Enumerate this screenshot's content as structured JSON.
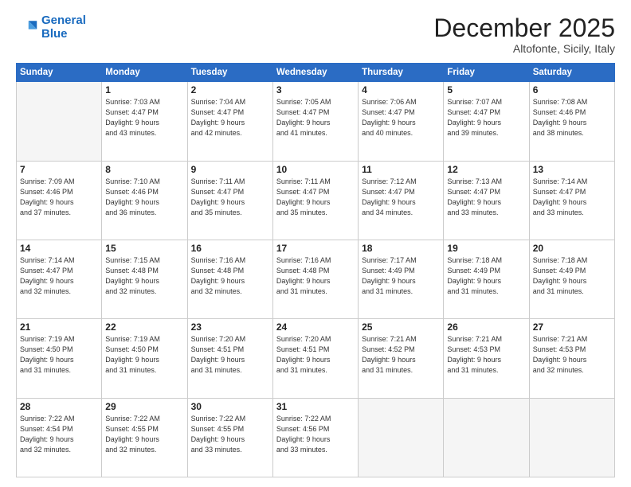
{
  "header": {
    "logo_line1": "General",
    "logo_line2": "Blue",
    "month": "December 2025",
    "location": "Altofonte, Sicily, Italy"
  },
  "weekdays": [
    "Sunday",
    "Monday",
    "Tuesday",
    "Wednesday",
    "Thursday",
    "Friday",
    "Saturday"
  ],
  "weeks": [
    [
      {
        "day": "",
        "info": ""
      },
      {
        "day": "1",
        "info": "Sunrise: 7:03 AM\nSunset: 4:47 PM\nDaylight: 9 hours\nand 43 minutes."
      },
      {
        "day": "2",
        "info": "Sunrise: 7:04 AM\nSunset: 4:47 PM\nDaylight: 9 hours\nand 42 minutes."
      },
      {
        "day": "3",
        "info": "Sunrise: 7:05 AM\nSunset: 4:47 PM\nDaylight: 9 hours\nand 41 minutes."
      },
      {
        "day": "4",
        "info": "Sunrise: 7:06 AM\nSunset: 4:47 PM\nDaylight: 9 hours\nand 40 minutes."
      },
      {
        "day": "5",
        "info": "Sunrise: 7:07 AM\nSunset: 4:47 PM\nDaylight: 9 hours\nand 39 minutes."
      },
      {
        "day": "6",
        "info": "Sunrise: 7:08 AM\nSunset: 4:46 PM\nDaylight: 9 hours\nand 38 minutes."
      }
    ],
    [
      {
        "day": "7",
        "info": "Sunrise: 7:09 AM\nSunset: 4:46 PM\nDaylight: 9 hours\nand 37 minutes."
      },
      {
        "day": "8",
        "info": "Sunrise: 7:10 AM\nSunset: 4:46 PM\nDaylight: 9 hours\nand 36 minutes."
      },
      {
        "day": "9",
        "info": "Sunrise: 7:11 AM\nSunset: 4:47 PM\nDaylight: 9 hours\nand 35 minutes."
      },
      {
        "day": "10",
        "info": "Sunrise: 7:11 AM\nSunset: 4:47 PM\nDaylight: 9 hours\nand 35 minutes."
      },
      {
        "day": "11",
        "info": "Sunrise: 7:12 AM\nSunset: 4:47 PM\nDaylight: 9 hours\nand 34 minutes."
      },
      {
        "day": "12",
        "info": "Sunrise: 7:13 AM\nSunset: 4:47 PM\nDaylight: 9 hours\nand 33 minutes."
      },
      {
        "day": "13",
        "info": "Sunrise: 7:14 AM\nSunset: 4:47 PM\nDaylight: 9 hours\nand 33 minutes."
      }
    ],
    [
      {
        "day": "14",
        "info": "Sunrise: 7:14 AM\nSunset: 4:47 PM\nDaylight: 9 hours\nand 32 minutes."
      },
      {
        "day": "15",
        "info": "Sunrise: 7:15 AM\nSunset: 4:48 PM\nDaylight: 9 hours\nand 32 minutes."
      },
      {
        "day": "16",
        "info": "Sunrise: 7:16 AM\nSunset: 4:48 PM\nDaylight: 9 hours\nand 32 minutes."
      },
      {
        "day": "17",
        "info": "Sunrise: 7:16 AM\nSunset: 4:48 PM\nDaylight: 9 hours\nand 31 minutes."
      },
      {
        "day": "18",
        "info": "Sunrise: 7:17 AM\nSunset: 4:49 PM\nDaylight: 9 hours\nand 31 minutes."
      },
      {
        "day": "19",
        "info": "Sunrise: 7:18 AM\nSunset: 4:49 PM\nDaylight: 9 hours\nand 31 minutes."
      },
      {
        "day": "20",
        "info": "Sunrise: 7:18 AM\nSunset: 4:49 PM\nDaylight: 9 hours\nand 31 minutes."
      }
    ],
    [
      {
        "day": "21",
        "info": "Sunrise: 7:19 AM\nSunset: 4:50 PM\nDaylight: 9 hours\nand 31 minutes."
      },
      {
        "day": "22",
        "info": "Sunrise: 7:19 AM\nSunset: 4:50 PM\nDaylight: 9 hours\nand 31 minutes."
      },
      {
        "day": "23",
        "info": "Sunrise: 7:20 AM\nSunset: 4:51 PM\nDaylight: 9 hours\nand 31 minutes."
      },
      {
        "day": "24",
        "info": "Sunrise: 7:20 AM\nSunset: 4:51 PM\nDaylight: 9 hours\nand 31 minutes."
      },
      {
        "day": "25",
        "info": "Sunrise: 7:21 AM\nSunset: 4:52 PM\nDaylight: 9 hours\nand 31 minutes."
      },
      {
        "day": "26",
        "info": "Sunrise: 7:21 AM\nSunset: 4:53 PM\nDaylight: 9 hours\nand 31 minutes."
      },
      {
        "day": "27",
        "info": "Sunrise: 7:21 AM\nSunset: 4:53 PM\nDaylight: 9 hours\nand 32 minutes."
      }
    ],
    [
      {
        "day": "28",
        "info": "Sunrise: 7:22 AM\nSunset: 4:54 PM\nDaylight: 9 hours\nand 32 minutes."
      },
      {
        "day": "29",
        "info": "Sunrise: 7:22 AM\nSunset: 4:55 PM\nDaylight: 9 hours\nand 32 minutes."
      },
      {
        "day": "30",
        "info": "Sunrise: 7:22 AM\nSunset: 4:55 PM\nDaylight: 9 hours\nand 33 minutes."
      },
      {
        "day": "31",
        "info": "Sunrise: 7:22 AM\nSunset: 4:56 PM\nDaylight: 9 hours\nand 33 minutes."
      },
      {
        "day": "",
        "info": ""
      },
      {
        "day": "",
        "info": ""
      },
      {
        "day": "",
        "info": ""
      }
    ]
  ]
}
